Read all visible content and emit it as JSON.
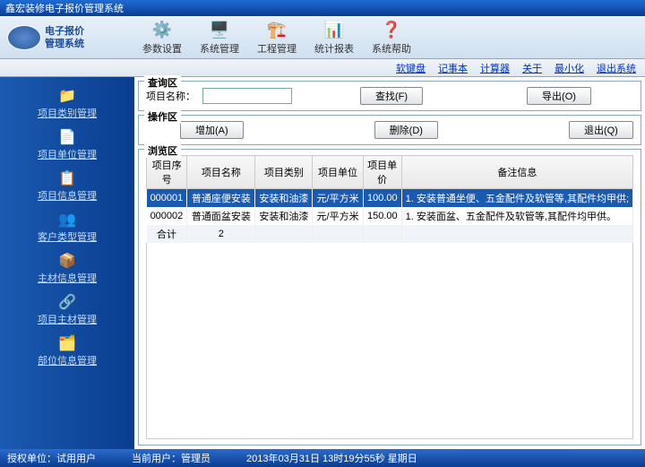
{
  "window": {
    "title": "鑫宏装修电子报价管理系统"
  },
  "logo": {
    "line1": "电子报价",
    "line2": "管理系统"
  },
  "toolbar": {
    "params": "参数设置",
    "system": "系统管理",
    "project": "工程管理",
    "report": "统计报表",
    "help": "系统帮助"
  },
  "links": {
    "keyboard": "软键盘",
    "notepad": "记事本",
    "calc": "计算器",
    "about": "关于",
    "minimize": "最小化",
    "exit": "退出系统"
  },
  "sidebar": {
    "itemCategory": "项目类别管理",
    "itemUnit": "项目单位管理",
    "itemInfo": "项目信息管理",
    "customerType": "客户类型管理",
    "materialInfo": "主材信息管理",
    "itemMaterial": "项目主材管理",
    "positionInfo": "部位信息管理"
  },
  "query": {
    "section": "查询区",
    "nameLabel": "项目名称：",
    "searchBtn": "查找(F)",
    "exportBtn": "导出(O)"
  },
  "ops": {
    "section": "操作区",
    "addBtn": "增加(A)",
    "deleteBtn": "删除(D)",
    "exitBtn": "退出(Q)"
  },
  "browse": {
    "section": "浏览区",
    "cols": {
      "seq": "项目序号",
      "name": "项目名称",
      "category": "项目类别",
      "unit": "项目单位",
      "price": "项目单价",
      "remark": "备注信息"
    },
    "rows": [
      {
        "seq": "000001",
        "name": "普通座便安装",
        "category": "安装和油漆",
        "unit": "元/平方米",
        "price": "100.00",
        "remark": "1. 安装普通坐便、五金配件及软管等,其配件均甲供;"
      },
      {
        "seq": "000002",
        "name": "普通面盆安装",
        "category": "安装和油漆",
        "unit": "元/平方米",
        "price": "150.00",
        "remark": "1. 安装面盆、五金配件及软管等,其配件均甲供。"
      }
    ],
    "total": {
      "label": "合计",
      "count": "2"
    }
  },
  "status": {
    "authLabel": "授权单位：",
    "authValue": "试用用户",
    "userLabel": "当前用户：",
    "userValue": "管理员",
    "datetime": "2013年03月31日 13时19分55秒 星期日"
  }
}
